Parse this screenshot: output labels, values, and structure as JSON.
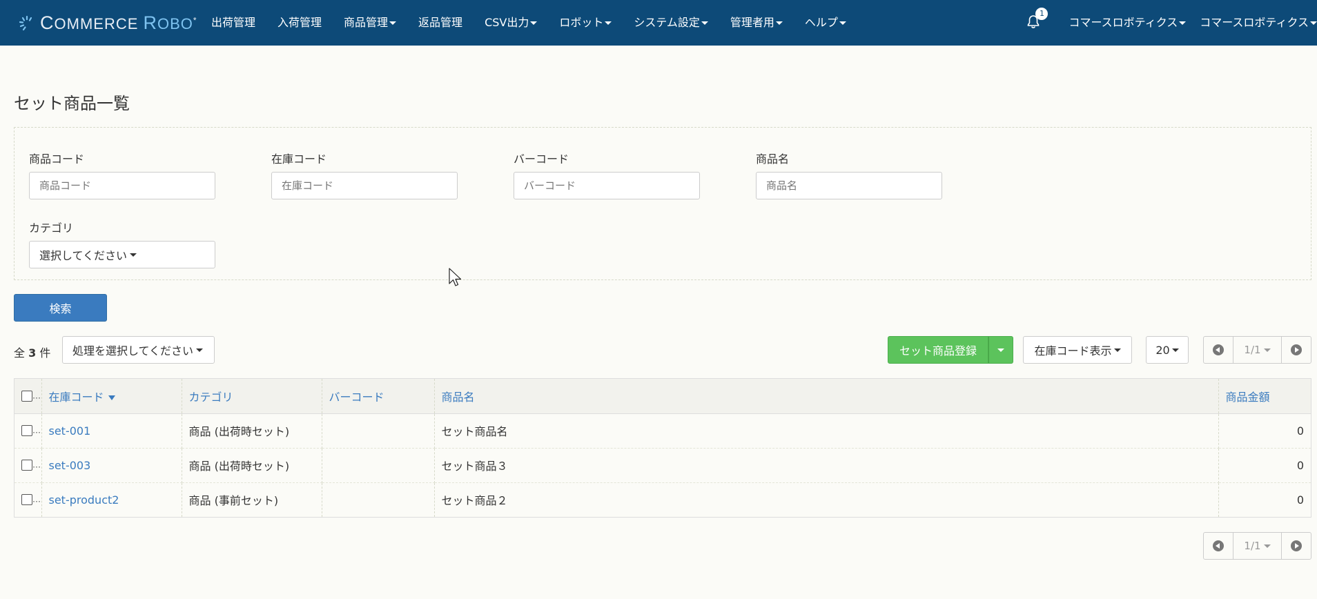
{
  "nav": {
    "brand_c": "C",
    "brand_ommerce": "OMMERCE ",
    "brand_r": "R",
    "brand_obo": "OBO",
    "brand_star": "*",
    "items": [
      {
        "label": "出荷管理",
        "dropdown": false
      },
      {
        "label": "入荷管理",
        "dropdown": false
      },
      {
        "label": "商品管理",
        "dropdown": true
      },
      {
        "label": "返品管理",
        "dropdown": false
      },
      {
        "label": "CSV出力",
        "dropdown": true
      },
      {
        "label": "ロボット",
        "dropdown": true
      },
      {
        "label": "システム設定",
        "dropdown": true
      },
      {
        "label": "管理者用",
        "dropdown": true
      },
      {
        "label": "ヘルプ",
        "dropdown": true
      }
    ],
    "notification_count": "1",
    "user_menu_1": "コマースロボティクス",
    "user_menu_2": "コマースロボティクス"
  },
  "page": {
    "title": "セット商品一覧"
  },
  "filters": {
    "product_code": {
      "label": "商品コード",
      "placeholder": "商品コード",
      "value": ""
    },
    "stock_code": {
      "label": "在庫コード",
      "placeholder": "在庫コード",
      "value": ""
    },
    "barcode": {
      "label": "バーコード",
      "placeholder": "バーコード",
      "value": ""
    },
    "product_name": {
      "label": "商品名",
      "placeholder": "商品名",
      "value": ""
    },
    "category": {
      "label": "カテゴリ",
      "selected": "選択してください"
    }
  },
  "search_button": "検索",
  "toolbar": {
    "count_prefix": "全",
    "count": "3",
    "count_suffix": "件",
    "action_select": "処理を選択してください",
    "register_button": "セット商品登録",
    "stock_code_display": "在庫コード表示",
    "per_page": "20",
    "page_indicator": "1/1"
  },
  "table": {
    "headers": {
      "checkbox_more": "…",
      "stock_code": "在庫コード",
      "category": "カテゴリ",
      "barcode": "バーコード",
      "product_name": "商品名",
      "price": "商品金額"
    },
    "rows": [
      {
        "stock_code": "set-001",
        "category": "商品 (出荷時セット)",
        "barcode": "",
        "product_name": "セット商品名",
        "price": "0"
      },
      {
        "stock_code": "set-003",
        "category": "商品 (出荷時セット)",
        "barcode": "",
        "product_name": "セット商品３",
        "price": "0"
      },
      {
        "stock_code": "set-product2",
        "category": "商品 (事前セット)",
        "barcode": "",
        "product_name": "セット商品２",
        "price": "0"
      }
    ]
  },
  "bottom_pager": {
    "page_indicator": "1/1"
  },
  "colors": {
    "navbar": "#0d4a78",
    "primary": "#3a7bbf",
    "success": "#5cc35c",
    "background": "#fbfbf7"
  }
}
